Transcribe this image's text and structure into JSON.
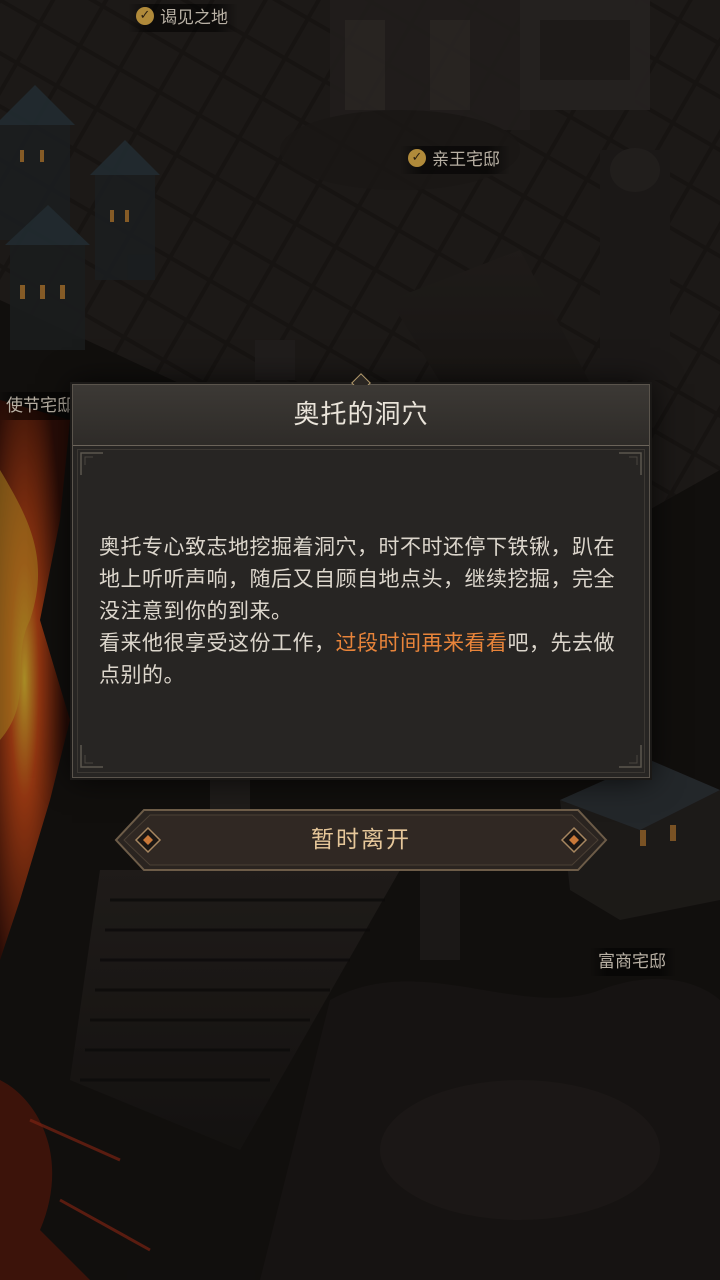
{
  "map": {
    "labels": [
      {
        "name": "map-label-meeting-place",
        "text": "谒见之地",
        "checked": true
      },
      {
        "name": "map-label-prince-mansion",
        "text": "亲王宅邸",
        "checked": true
      },
      {
        "name": "map-label-envoy-mansion",
        "text": "使节宅邸",
        "checked": false
      },
      {
        "name": "map-label-merchant-mansion",
        "text": "富商宅邸",
        "checked": false
      }
    ]
  },
  "dialog": {
    "title": "奥托的洞穴",
    "paragraph1": "奥托专心致志地挖掘着洞穴，时不时还停下铁锹，趴在地上听听声响，随后又自顾自地点头，继续挖掘，完全没注意到你的到来。",
    "paragraph2_before": "看来他很享受这份工作，",
    "paragraph2_highlight": "过段时间再来看看",
    "paragraph2_after": "吧，先去做点别的。"
  },
  "button": {
    "leave_label": "暂时离开"
  },
  "colors": {
    "highlight": "#e8843a",
    "button_text": "#e6c79a",
    "lava": "#c8401a",
    "check_badge": "#b08a3a"
  }
}
